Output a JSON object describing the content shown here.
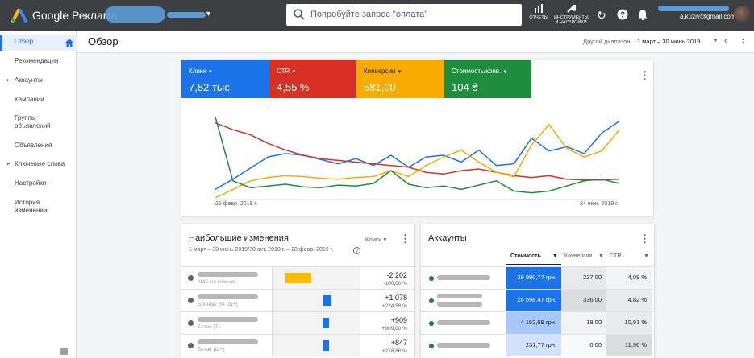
{
  "topbar": {
    "brand": "Google Реклама",
    "search_placeholder": "Попробуйте запрос \"оплата\"",
    "reports_label": "ОТЧЕТЫ",
    "tools_label": "ИНСТРУМЕНТЫ И НАСТРОЙКИ",
    "email": "a.kuziv@gmail.com"
  },
  "sidebar": {
    "items": [
      {
        "label": "Обзор",
        "active": true
      },
      {
        "label": "Рекомендации"
      },
      {
        "label": "Аккаунты",
        "caret": true
      },
      {
        "label": "Кампании"
      },
      {
        "label": "Группы объявлений"
      },
      {
        "label": "Объявления"
      },
      {
        "label": "Ключевые слова",
        "caret": true
      },
      {
        "label": "Настройки"
      },
      {
        "label": "История изменений"
      }
    ]
  },
  "header": {
    "title": "Обзор",
    "range_label": "Другой диапазон",
    "range_value": "1 март – 30 июнь 2019"
  },
  "metrics": [
    {
      "label": "Клики",
      "value": "7,82 тыс.",
      "color": "#1a73e8"
    },
    {
      "label": "CTR",
      "value": "4,55 %",
      "color": "#d93025"
    },
    {
      "label": "Конверсии",
      "value": "581,00",
      "color": "#f9ab00"
    },
    {
      "label": "Стоимость/конв.",
      "value": "104 ₴",
      "color": "#1e8e3e"
    }
  ],
  "chart_data": {
    "type": "line",
    "x_start_label": "25 февр. 2019 г.",
    "x_end_label": "24 июн. 2019 г.",
    "series": [
      {
        "name": "Клики",
        "color": "#1a73e8",
        "values": [
          10,
          22,
          35,
          48,
          52,
          50,
          45,
          40,
          46,
          38,
          50,
          36,
          48,
          50,
          42,
          56,
          38,
          40,
          70,
          55,
          60,
          52,
          76,
          90
        ]
      },
      {
        "name": "CTR",
        "color": "#d93025",
        "values": [
          88,
          80,
          74,
          64,
          56,
          50,
          46,
          44,
          42,
          40,
          38,
          36,
          30,
          28,
          32,
          34,
          30,
          26,
          24,
          26,
          22,
          21,
          21,
          22
        ]
      },
      {
        "name": "Конверсии",
        "color": "#f9ab00",
        "values": [
          0,
          10,
          20,
          24,
          26,
          25,
          23,
          22,
          24,
          25,
          32,
          25,
          38,
          48,
          56,
          42,
          30,
          25,
          62,
          86,
          58,
          48,
          55,
          80
        ]
      },
      {
        "name": "Стоимость/конв.",
        "color": "#1e8e3e",
        "values": [
          95,
          20,
          12,
          14,
          16,
          13,
          12,
          15,
          14,
          17,
          32,
          16,
          12,
          14,
          10,
          15,
          20,
          8,
          6,
          8,
          14,
          20,
          22,
          17
        ]
      }
    ]
  },
  "changes": {
    "title": "Наибольшие изменения",
    "selector": "Клики",
    "subtitle": "1 март – 30 июнь 2019/30 окт. 2018 г. – 28 февр. 2019 г.",
    "rows": [
      {
        "sub": "КМС по ключам",
        "v1": "-2 202",
        "v2": "-100,00 %",
        "bar": "#fbbc04",
        "bar_frac": 0.42,
        "side": "left"
      },
      {
        "sub": "Бренды ВЧ (Ш+)",
        "v1": "+1 078",
        "v2": "+224,58 %",
        "bar": "#1a73e8",
        "bar_frac": 0.23,
        "side": "right"
      },
      {
        "sub": "Бетон (Т)",
        "v1": "+909",
        "v2": "+909,00 %",
        "bar": "#1a73e8",
        "bar_frac": 0.2,
        "side": "right"
      },
      {
        "sub": "Бетон (Ш+)",
        "v1": "+847",
        "v2": "+218,86 %",
        "bar": "#1a73e8",
        "bar_frac": 0.19,
        "side": "right"
      }
    ]
  },
  "accounts": {
    "title": "Аккаунты",
    "col_cost": "Стоимость",
    "col_conv": "Конверсии",
    "col_ctr": "CTR",
    "rows": [
      {
        "cost": "29 990,77 грн.",
        "conv": "227,00",
        "ctr": "4,09 %"
      },
      {
        "cost": "26 598,47 грн.",
        "conv": "336,00",
        "ctr": "4,82 %"
      },
      {
        "cost": "4 152,69 грн.",
        "conv": "18,00",
        "ctr": "10,91 %"
      },
      {
        "cost": "231,77 грн.",
        "conv": "0,00",
        "ctr": "11,96 %"
      }
    ]
  }
}
